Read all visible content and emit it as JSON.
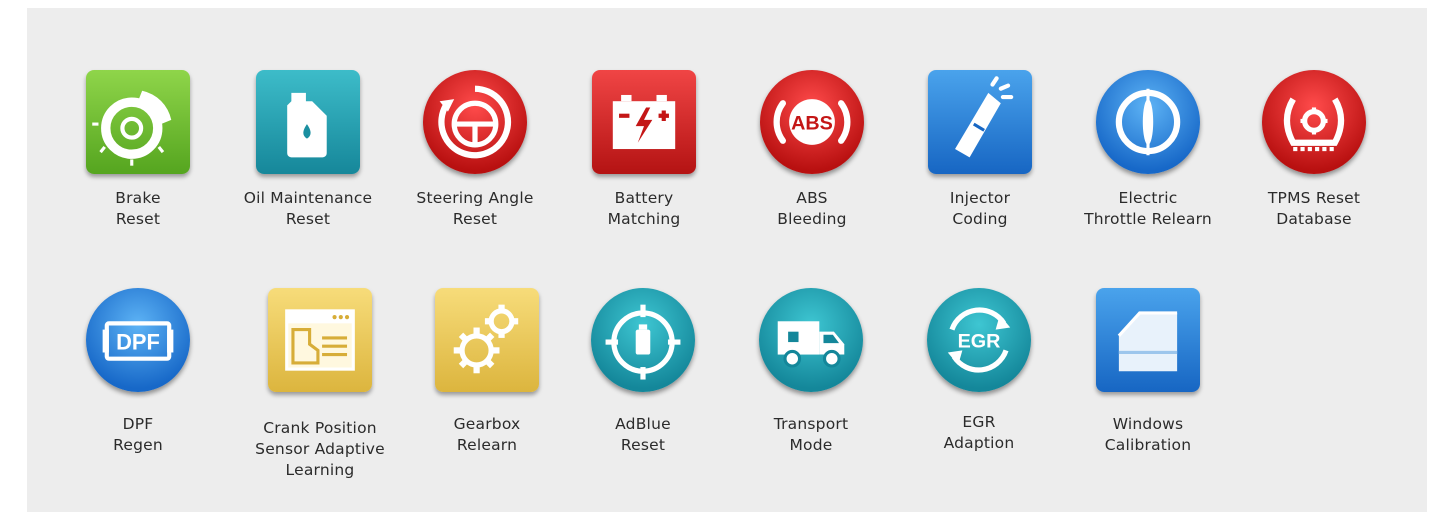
{
  "functions": [
    {
      "id": "brake",
      "lines": [
        "Brake",
        "Reset"
      ],
      "icon": "brake-disc-icon",
      "color": "#6cc02e"
    },
    {
      "id": "oil",
      "lines": [
        "Oil Maintenance",
        "Reset"
      ],
      "icon": "oil-can-icon",
      "color": "#22a2b4"
    },
    {
      "id": "steering",
      "lines": [
        "Steering Angle",
        "Reset"
      ],
      "icon": "steering-wheel-icon",
      "color": "#d61f1f"
    },
    {
      "id": "battery",
      "lines": [
        "Battery",
        "Matching"
      ],
      "icon": "battery-icon",
      "color": "#d61f1f"
    },
    {
      "id": "abs",
      "lines": [
        "ABS",
        "Bleeding"
      ],
      "icon": "abs-icon",
      "color": "#d61f1f",
      "icon_text": "ABS"
    },
    {
      "id": "injector",
      "lines": [
        "Injector",
        "Coding"
      ],
      "icon": "injector-icon",
      "color": "#2a7fd8"
    },
    {
      "id": "throttle",
      "lines": [
        "Electric",
        "Throttle Relearn"
      ],
      "icon": "throttle-icon",
      "color": "#2a7fd8"
    },
    {
      "id": "tpms",
      "lines": [
        "TPMS Reset",
        "Database"
      ],
      "icon": "tire-pressure-icon",
      "color": "#d61f1f"
    },
    {
      "id": "dpf",
      "lines": [
        "DPF",
        "Regen"
      ],
      "icon": "dpf-icon",
      "color": "#2a7fd8",
      "icon_text": "DPF"
    },
    {
      "id": "crank",
      "lines": [
        "Crank Position",
        "Sensor Adaptive",
        "Learning"
      ],
      "icon": "crank-sensor-icon",
      "color": "#e9c555"
    },
    {
      "id": "gearbox",
      "lines": [
        "Gearbox",
        "Relearn"
      ],
      "icon": "gears-icon",
      "color": "#e9c555"
    },
    {
      "id": "adblue",
      "lines": [
        "AdBlue",
        "Reset"
      ],
      "icon": "adblue-icon",
      "color": "#1ea6b5"
    },
    {
      "id": "transport",
      "lines": [
        "Transport",
        "Mode"
      ],
      "icon": "truck-icon",
      "color": "#1ea6b5"
    },
    {
      "id": "egr",
      "lines": [
        "EGR",
        "Adaption"
      ],
      "icon": "egr-icon",
      "color": "#1ea6b5",
      "icon_text": "EGR"
    },
    {
      "id": "windows",
      "lines": [
        "Windows",
        "Calibration"
      ],
      "icon": "car-window-icon",
      "color": "#2a7fd8"
    }
  ]
}
